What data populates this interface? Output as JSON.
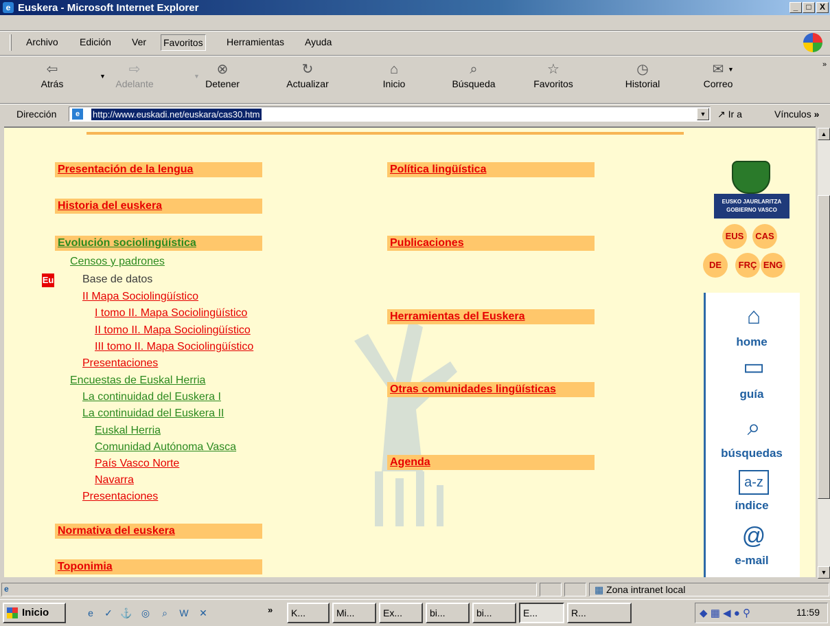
{
  "window": {
    "title": "Euskera - Microsoft Internet Explorer",
    "controls": [
      "_",
      "□",
      "X"
    ]
  },
  "menu": [
    "Archivo",
    "Edición",
    "Ver",
    "Favoritos",
    "Herramientas",
    "Ayuda"
  ],
  "toolbar": [
    {
      "label": "Atrás",
      "icon": "back-arrow-icon",
      "glyph": "⇦"
    },
    {
      "label": "Adelante",
      "icon": "forward-arrow-icon",
      "glyph": "⇨",
      "disabled": true
    },
    {
      "label": "Detener",
      "icon": "stop-icon",
      "glyph": "⊗"
    },
    {
      "label": "Actualizar",
      "icon": "refresh-icon",
      "glyph": "↻"
    },
    {
      "label": "Inicio",
      "icon": "home-icon",
      "glyph": "⌂"
    },
    {
      "label": "Búsqueda",
      "icon": "search-icon",
      "glyph": "⌕"
    },
    {
      "label": "Favoritos",
      "icon": "favorites-icon",
      "glyph": "☆"
    },
    {
      "label": "Historial",
      "icon": "history-icon",
      "glyph": "◷"
    },
    {
      "label": "Correo",
      "icon": "mail-icon",
      "glyph": "✉"
    }
  ],
  "address": {
    "label": "Dirección",
    "url": "http://www.euskadi.net/euskara/cas30.htm",
    "go": "Ir a",
    "links": "Vínculos"
  },
  "left_nav": {
    "presentacion": "Presentación de la lengua",
    "historia": "Historia del euskera",
    "evolucion": "Evolución sociolingüística",
    "normativa": "Normativa del euskera",
    "toponimia": "Toponimia",
    "eu_badge": "Eu",
    "subitems": [
      "Censos y padrones",
      "Base de datos",
      "II Mapa Sociolingüístico",
      "I tomo II. Mapa Sociolingüístico",
      "II tomo II. Mapa Sociolingüístico",
      "III tomo II. Mapa Sociolingüístico",
      "Presentaciones",
      "Encuestas de Euskal Herria",
      "La continuidad del Euskera I",
      "La continuidad del Euskera II",
      "Euskal Herria",
      "Comunidad Autónoma Vasca",
      "País Vasco Norte",
      "Navarra",
      "Presentaciones"
    ]
  },
  "mid_nav": [
    "Política lingüística",
    "Publicaciones",
    "Herramientas del Euskera",
    "Otras comunidades lingüísticas",
    "Agenda"
  ],
  "logo_text": "EUSKO JAURLARITZA\nGOBIERNO VASCO",
  "languages": [
    "EUS",
    "CAS",
    "DE",
    "FRÇ",
    "ENG"
  ],
  "side_nav": [
    {
      "label": "home",
      "glyph": "⌂"
    },
    {
      "label": "guía",
      "glyph": "▭"
    },
    {
      "label": "búsquedas",
      "glyph": "⌕"
    },
    {
      "label": "índice",
      "glyph": "a-z"
    },
    {
      "label": "e-mail",
      "glyph": "@"
    }
  ],
  "status": {
    "zone": "Zona intranet local"
  },
  "taskbar": {
    "start": "Inicio",
    "quicklaunch": [
      "e",
      "✓",
      "⚓",
      "◎",
      "⌕",
      "W",
      "✕"
    ],
    "tasks": [
      "K...",
      "Mi...",
      "Ex...",
      "bi...",
      "bi...",
      "E...",
      "R..."
    ],
    "clock": "11:59"
  }
}
